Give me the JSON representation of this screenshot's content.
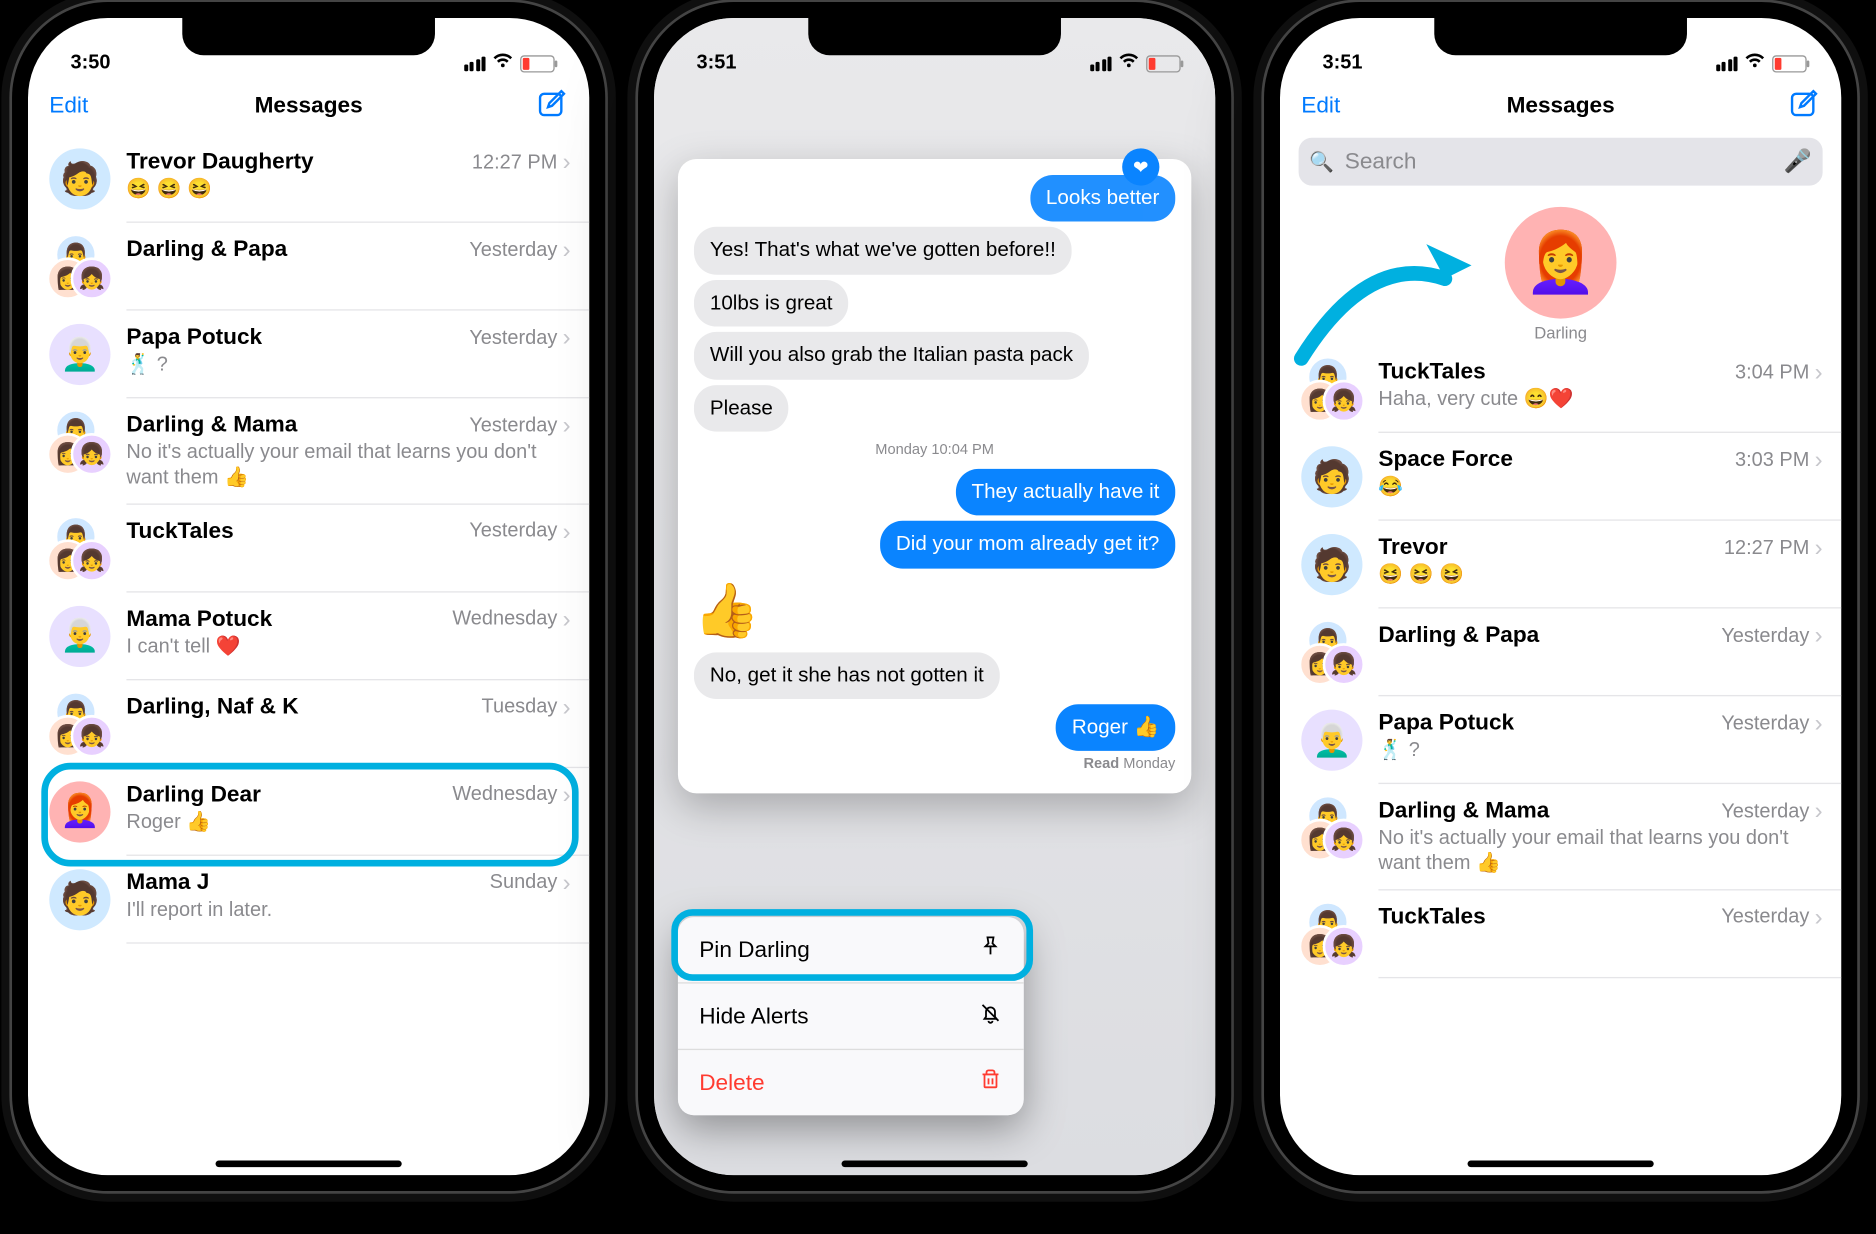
{
  "phone1": {
    "time": "3:50",
    "nav": {
      "edit": "Edit",
      "title": "Messages"
    },
    "conversations": [
      {
        "name": "Trevor Daugherty",
        "time": "12:27 PM",
        "preview": "😆 😆 😆",
        "avatar": "single-blue"
      },
      {
        "name": "Darling & Papa",
        "time": "Yesterday",
        "preview": "",
        "avatar": "group"
      },
      {
        "name": "Papa Potuck",
        "time": "Yesterday",
        "preview": "🕺 ?",
        "avatar": "single-lav"
      },
      {
        "name": "Darling & Mama",
        "time": "Yesterday",
        "preview": "No it's actually your email that learns you don't want them 👍",
        "avatar": "group"
      },
      {
        "name": "TuckTales",
        "time": "Yesterday",
        "preview": "",
        "avatar": "group"
      },
      {
        "name": "Mama Potuck",
        "time": "Wednesday",
        "preview": "I can't tell ❤️",
        "avatar": "single-lav"
      },
      {
        "name": "Darling, Naf & K",
        "time": "Tuesday",
        "preview": "",
        "avatar": "group"
      },
      {
        "name": "Darling Dear",
        "time": "Wednesday",
        "preview": "Roger 👍",
        "avatar": "single-pink",
        "highlight": true
      },
      {
        "name": "Mama J",
        "time": "Sunday",
        "preview": "I'll report in later.",
        "avatar": "single-blue"
      }
    ]
  },
  "phone2": {
    "time": "3:51",
    "messages": {
      "top_cut": "Looks better",
      "recv": [
        "Yes! That's what we've gotten before!!",
        "10lbs is great",
        "Will you also grab the Italian pasta pack",
        "Please"
      ],
      "timestamp": "Monday 10:04 PM",
      "send": [
        "They actually have it",
        "Did your mom already get it?"
      ],
      "recv2": "No, get it she has not gotten it",
      "send2": "Roger 👍",
      "receipt": {
        "status": "Read",
        "when": "Monday"
      }
    },
    "menu": [
      {
        "label": "Pin Darling",
        "icon": "pin",
        "highlight": true
      },
      {
        "label": "Hide Alerts",
        "icon": "bell-slash"
      },
      {
        "label": "Delete",
        "icon": "trash",
        "danger": true
      }
    ]
  },
  "phone3": {
    "time": "3:51",
    "nav": {
      "edit": "Edit",
      "title": "Messages"
    },
    "search_placeholder": "Search",
    "pinned": {
      "label": "Darling"
    },
    "conversations": [
      {
        "name": "TuckTales",
        "time": "3:04 PM",
        "preview": "Haha, very cute 😄❤️",
        "avatar": "group"
      },
      {
        "name": "Space Force",
        "time": "3:03 PM",
        "preview": "😂",
        "avatar": "single-blue"
      },
      {
        "name": "Trevor",
        "time": "12:27 PM",
        "preview": "😆 😆 😆",
        "avatar": "single-blue"
      },
      {
        "name": "Darling & Papa",
        "time": "Yesterday",
        "preview": "",
        "avatar": "group"
      },
      {
        "name": "Papa Potuck",
        "time": "Yesterday",
        "preview": "🕺 ?",
        "avatar": "single-lav"
      },
      {
        "name": "Darling & Mama",
        "time": "Yesterday",
        "preview": "No it's actually your email that learns you don't want them 👍",
        "avatar": "group"
      },
      {
        "name": "TuckTales",
        "time": "Yesterday",
        "preview": "",
        "avatar": "group"
      }
    ]
  }
}
